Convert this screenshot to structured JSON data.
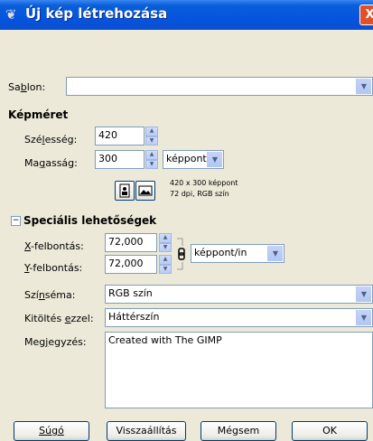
{
  "window": {
    "title": "Új kép létrehozása",
    "close_glyph": "X",
    "icon": "gimp-icon"
  },
  "template": {
    "label": "Sablon:",
    "value": ""
  },
  "image_size": {
    "heading": "Képméret",
    "width_label": "Szélesség:",
    "width_value": "420",
    "height_label": "Magasság:",
    "height_value": "300",
    "unit": "képpont",
    "info_line1": "420 x 300 képpont",
    "info_line2": "72 dpi, RGB szín"
  },
  "advanced": {
    "heading": "Speciális lehetőségek",
    "toggle_glyph": "−",
    "x_res_label": "X-felbontás:",
    "x_res_value": "72,000",
    "y_res_label": "Y-felbontás:",
    "y_res_value": "72,000",
    "res_unit": "képpont/in",
    "colorspace_label": "Színséma:",
    "colorspace_value": "RGB szín",
    "fill_label": "Kitöltés ezzel:",
    "fill_value": "Háttérszín",
    "comment_label": "Megjegyzés:",
    "comment_value": "Created with The GIMP"
  },
  "buttons": {
    "help": "Súgó",
    "reset": "Visszaállítás",
    "cancel": "Mégsem",
    "ok": "OK"
  }
}
